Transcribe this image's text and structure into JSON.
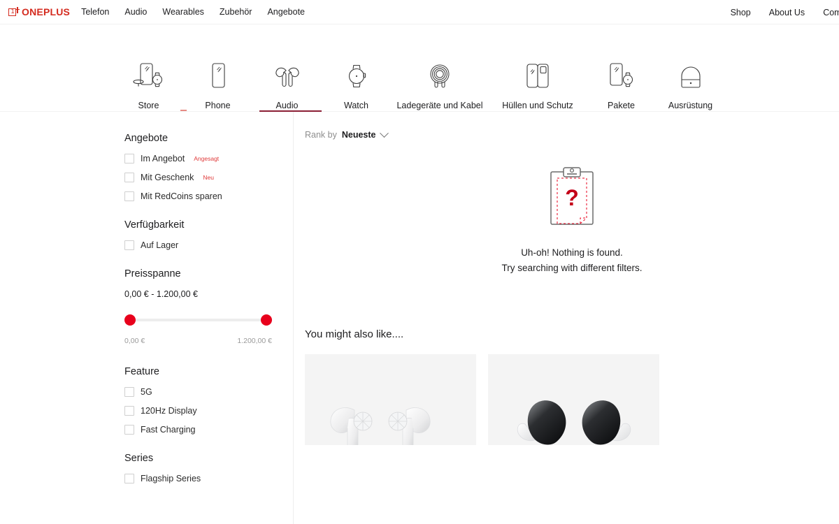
{
  "header": {
    "logo_text": "ONEPLUS",
    "logo_digit": "1",
    "nav_left": [
      {
        "label": "Telefon",
        "name": "nav-telefon"
      },
      {
        "label": "Audio",
        "name": "nav-audio"
      },
      {
        "label": "Wearables",
        "name": "nav-wearables"
      },
      {
        "label": "Zubehör",
        "name": "nav-zubehor"
      },
      {
        "label": "Angebote",
        "name": "nav-angebote"
      }
    ],
    "nav_right": [
      {
        "label": "Shop",
        "name": "nav-shop"
      },
      {
        "label": "About Us",
        "name": "nav-about-us"
      },
      {
        "label": "Comm",
        "name": "nav-community"
      }
    ]
  },
  "categories": [
    {
      "label": "Store",
      "icon": "store-icon"
    },
    {
      "label": "Phone",
      "icon": "phone-icon"
    },
    {
      "label": "Audio",
      "icon": "audio-earbuds-icon"
    },
    {
      "label": "Watch",
      "icon": "watch-icon"
    },
    {
      "label": "Ladegeräte und Kabel",
      "icon": "cable-icon"
    },
    {
      "label": "Hüllen und Schutz",
      "icon": "case-icon"
    },
    {
      "label": "Pakete",
      "icon": "bundle-icon"
    },
    {
      "label": "Ausrüstung",
      "icon": "backpack-icon"
    }
  ],
  "sidebar": {
    "groups": [
      {
        "title": "Angebote",
        "name": "filter-group-angebote",
        "options": [
          {
            "label": "Im Angebot",
            "badge": "Angesagt"
          },
          {
            "label": "Mit Geschenk",
            "badge": "Neu"
          },
          {
            "label": "Mit RedCoins sparen",
            "badge": ""
          }
        ]
      },
      {
        "title": "Verfügbarkeit",
        "name": "filter-group-verfugbarkeit",
        "options": [
          {
            "label": "Auf Lager",
            "badge": ""
          }
        ]
      }
    ],
    "price": {
      "title": "Preisspanne",
      "value": "0,00 € - 1.200,00 €",
      "min_label": "0,00 €",
      "max_label": "1.200,00 €"
    },
    "groups2": [
      {
        "title": "Feature",
        "name": "filter-group-feature",
        "options": [
          {
            "label": "5G",
            "badge": ""
          },
          {
            "label": "120Hz Display",
            "badge": ""
          },
          {
            "label": "Fast Charging",
            "badge": ""
          }
        ]
      },
      {
        "title": "Series",
        "name": "filter-group-series",
        "options": [
          {
            "label": "Flagship Series",
            "badge": ""
          }
        ]
      }
    ]
  },
  "main": {
    "rank_by_label": "Rank by",
    "rank_by_value": "Neueste",
    "empty_line1": "Uh-oh! Nothing is found.",
    "empty_line2": "Try searching with different filters.",
    "suggest_title": "You might also like....",
    "cards": [
      {
        "name": "product-card-buds-white",
        "art": "white-earbuds"
      },
      {
        "name": "product-card-buds-black",
        "art": "black-earbuds"
      }
    ]
  },
  "colors": {
    "brand_red": "#d42b1f",
    "slider_red": "#e8001c",
    "tab_underline": "#8b1f35",
    "badge_red": "#e03b3b"
  }
}
